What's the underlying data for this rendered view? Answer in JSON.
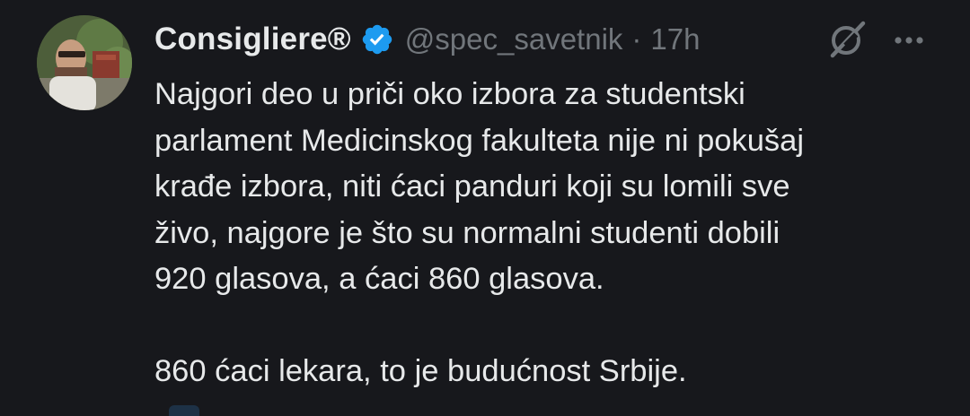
{
  "tweet": {
    "display_name": "Consigliere®",
    "handle": "@spec_savetnik",
    "separator": "·",
    "time": "17h",
    "verified": true,
    "body": "Najgori deo u priči oko izbora za studentski\nparlament Medicinskog fakulteta nije ni pokušaj\nkrađe izbora, niti ćaci panduri koji su lomili sve\nživo, najgore je što su normalni studenti dobili\n920 glasova, a ćaci 860 glasova.\n\n860 ćaci lekara, to je budućnost Srbije."
  },
  "icons": {
    "verified": "verified-badge-icon",
    "grok": "grok-icon",
    "more": "more-options-icon"
  },
  "colors": {
    "background": "#17181c",
    "text": "#e7e9ea",
    "muted": "#71767b",
    "verified": "#1d9bf0"
  }
}
